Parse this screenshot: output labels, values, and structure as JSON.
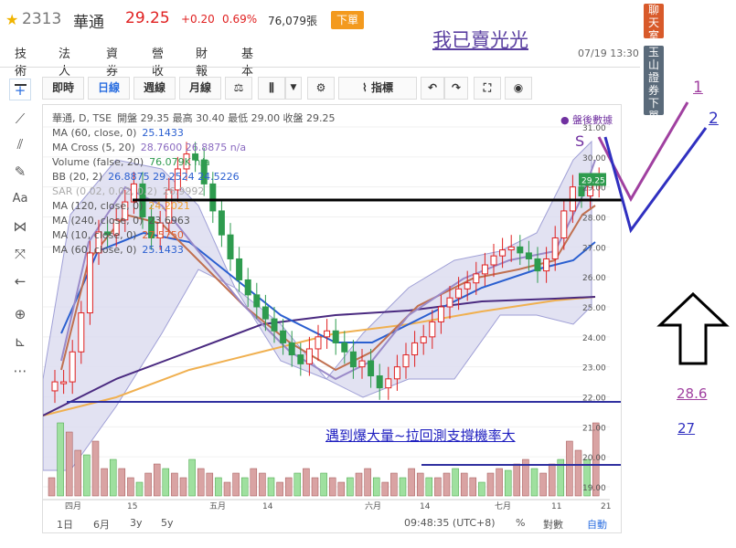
{
  "header": {
    "code": "2313",
    "name": "華通",
    "price": "29.25",
    "change": "+0.20",
    "change_pct": "0.69%",
    "volume": "76,079張",
    "sell_label": "下單",
    "datetime": "07/19 13:30"
  },
  "annotations": {
    "banner": "我已賣光光",
    "s_label": "S",
    "num_1": "1",
    "num_2": "2",
    "price_a": "28.6",
    "price_b": "27",
    "support_text": "遇到爆大量~拉回測支撐機率大"
  },
  "tabs": [
    "技術",
    "法人",
    "資券",
    "營收",
    "財報",
    "基本"
  ],
  "toolbar": {
    "intraday": "即時",
    "daily": "日線",
    "weekly": "週線",
    "monthly": "月線",
    "indicators": "指標"
  },
  "right_buttons": {
    "chat": "聊天室",
    "broker": "玉山證券下單"
  },
  "after_hours": "● 盤後數據",
  "indicators": [
    {
      "label": "華通, D, TSE",
      "value": "開盤 29.35 最高 30.40 最低 29.00 收盤 29.25"
    },
    {
      "label": "MA (60, close, 0)",
      "value": "25.1433"
    },
    {
      "label": "MA Cross (5, 20)",
      "value": "28.7600 26.8875 n/a"
    },
    {
      "label": "Volume (false, 20)",
      "value": "76.079K n/a"
    },
    {
      "label": "BB (20, 2)",
      "value": "26.8875 29.2524 24.5226"
    },
    {
      "label": "SAR (0.02, 0.02, 0.2)",
      "value": "26.9992"
    },
    {
      "label": "MA (120, close, 0)",
      "value": "24.2021"
    },
    {
      "label": "MA (240, close, 0)",
      "value": "23.6963"
    },
    {
      "label": "MA (10, close, 0)",
      "value": "27.5750"
    },
    {
      "label": "MA (60, close, 0)",
      "value": "25.1433"
    }
  ],
  "y_axis": [
    "31.00",
    "30.00",
    "29.00",
    "28.00",
    "27.00",
    "26.00",
    "25.00",
    "24.00",
    "23.00",
    "22.00",
    "21.00",
    "20.00",
    "19.00"
  ],
  "y_last": "29.25",
  "x_axis": [
    "四月",
    "15",
    "五月",
    "14",
    "六月",
    "14",
    "七月",
    "11",
    "21"
  ],
  "bottom": {
    "range_1d": "1日",
    "range_6m": "6月",
    "range_3y": "3y",
    "range_5y": "5y",
    "time": "09:48:35 (UTC+8)",
    "pct": "%",
    "log": "對數",
    "auto": "自動"
  },
  "colors": {
    "up": "#e02020",
    "down": "#2e9b4e",
    "bb_fill": "#c8c8e8",
    "annotation_purple": "#a040a0",
    "annotation_blue": "#3030c0"
  }
}
